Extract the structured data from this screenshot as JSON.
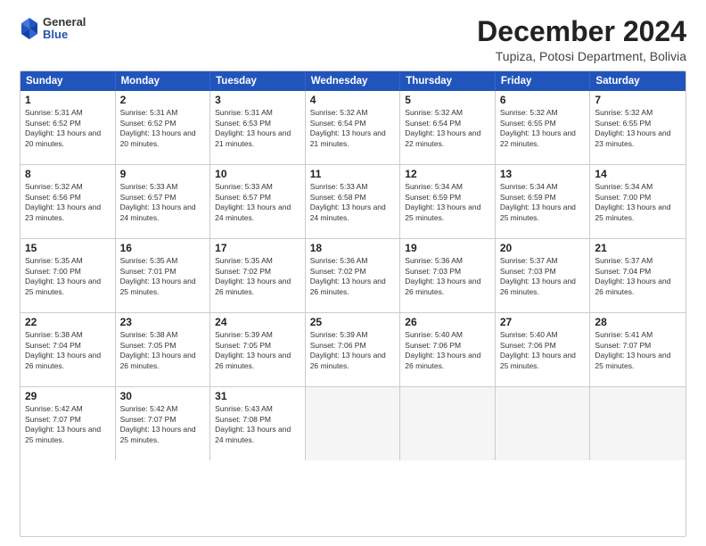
{
  "logo": {
    "general": "General",
    "blue": "Blue"
  },
  "title": "December 2024",
  "location": "Tupiza, Potosi Department, Bolivia",
  "days": [
    "Sunday",
    "Monday",
    "Tuesday",
    "Wednesday",
    "Thursday",
    "Friday",
    "Saturday"
  ],
  "weeks": [
    [
      {
        "day": "1",
        "sunrise": "5:31 AM",
        "sunset": "6:52 PM",
        "daylight": "13 hours and 20 minutes."
      },
      {
        "day": "2",
        "sunrise": "5:31 AM",
        "sunset": "6:52 PM",
        "daylight": "13 hours and 20 minutes."
      },
      {
        "day": "3",
        "sunrise": "5:31 AM",
        "sunset": "6:53 PM",
        "daylight": "13 hours and 21 minutes."
      },
      {
        "day": "4",
        "sunrise": "5:32 AM",
        "sunset": "6:54 PM",
        "daylight": "13 hours and 21 minutes."
      },
      {
        "day": "5",
        "sunrise": "5:32 AM",
        "sunset": "6:54 PM",
        "daylight": "13 hours and 22 minutes."
      },
      {
        "day": "6",
        "sunrise": "5:32 AM",
        "sunset": "6:55 PM",
        "daylight": "13 hours and 22 minutes."
      },
      {
        "day": "7",
        "sunrise": "5:32 AM",
        "sunset": "6:55 PM",
        "daylight": "13 hours and 23 minutes."
      }
    ],
    [
      {
        "day": "8",
        "sunrise": "5:32 AM",
        "sunset": "6:56 PM",
        "daylight": "13 hours and 23 minutes."
      },
      {
        "day": "9",
        "sunrise": "5:33 AM",
        "sunset": "6:57 PM",
        "daylight": "13 hours and 24 minutes."
      },
      {
        "day": "10",
        "sunrise": "5:33 AM",
        "sunset": "6:57 PM",
        "daylight": "13 hours and 24 minutes."
      },
      {
        "day": "11",
        "sunrise": "5:33 AM",
        "sunset": "6:58 PM",
        "daylight": "13 hours and 24 minutes."
      },
      {
        "day": "12",
        "sunrise": "5:34 AM",
        "sunset": "6:59 PM",
        "daylight": "13 hours and 25 minutes."
      },
      {
        "day": "13",
        "sunrise": "5:34 AM",
        "sunset": "6:59 PM",
        "daylight": "13 hours and 25 minutes."
      },
      {
        "day": "14",
        "sunrise": "5:34 AM",
        "sunset": "7:00 PM",
        "daylight": "13 hours and 25 minutes."
      }
    ],
    [
      {
        "day": "15",
        "sunrise": "5:35 AM",
        "sunset": "7:00 PM",
        "daylight": "13 hours and 25 minutes."
      },
      {
        "day": "16",
        "sunrise": "5:35 AM",
        "sunset": "7:01 PM",
        "daylight": "13 hours and 25 minutes."
      },
      {
        "day": "17",
        "sunrise": "5:35 AM",
        "sunset": "7:02 PM",
        "daylight": "13 hours and 26 minutes."
      },
      {
        "day": "18",
        "sunrise": "5:36 AM",
        "sunset": "7:02 PM",
        "daylight": "13 hours and 26 minutes."
      },
      {
        "day": "19",
        "sunrise": "5:36 AM",
        "sunset": "7:03 PM",
        "daylight": "13 hours and 26 minutes."
      },
      {
        "day": "20",
        "sunrise": "5:37 AM",
        "sunset": "7:03 PM",
        "daylight": "13 hours and 26 minutes."
      },
      {
        "day": "21",
        "sunrise": "5:37 AM",
        "sunset": "7:04 PM",
        "daylight": "13 hours and 26 minutes."
      }
    ],
    [
      {
        "day": "22",
        "sunrise": "5:38 AM",
        "sunset": "7:04 PM",
        "daylight": "13 hours and 26 minutes."
      },
      {
        "day": "23",
        "sunrise": "5:38 AM",
        "sunset": "7:05 PM",
        "daylight": "13 hours and 26 minutes."
      },
      {
        "day": "24",
        "sunrise": "5:39 AM",
        "sunset": "7:05 PM",
        "daylight": "13 hours and 26 minutes."
      },
      {
        "day": "25",
        "sunrise": "5:39 AM",
        "sunset": "7:06 PM",
        "daylight": "13 hours and 26 minutes."
      },
      {
        "day": "26",
        "sunrise": "5:40 AM",
        "sunset": "7:06 PM",
        "daylight": "13 hours and 26 minutes."
      },
      {
        "day": "27",
        "sunrise": "5:40 AM",
        "sunset": "7:06 PM",
        "daylight": "13 hours and 25 minutes."
      },
      {
        "day": "28",
        "sunrise": "5:41 AM",
        "sunset": "7:07 PM",
        "daylight": "13 hours and 25 minutes."
      }
    ],
    [
      {
        "day": "29",
        "sunrise": "5:42 AM",
        "sunset": "7:07 PM",
        "daylight": "13 hours and 25 minutes."
      },
      {
        "day": "30",
        "sunrise": "5:42 AM",
        "sunset": "7:07 PM",
        "daylight": "13 hours and 25 minutes."
      },
      {
        "day": "31",
        "sunrise": "5:43 AM",
        "sunset": "7:08 PM",
        "daylight": "13 hours and 24 minutes."
      },
      null,
      null,
      null,
      null
    ]
  ]
}
